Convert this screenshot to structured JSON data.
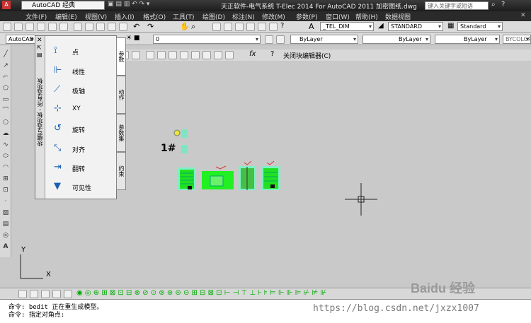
{
  "window": {
    "workspace": "AutoCAD 经典",
    "title": "天正软件-电气系统 T-Elec 2014  For AutoCAD 2011    加密图纸.dwg",
    "search_placeholder": "键入关键字或短语"
  },
  "menu": [
    "文件(F)",
    "编辑(E)",
    "视图(V)",
    "插入(I)",
    "格式(O)",
    "工具(T)",
    "绘图(D)",
    "标注(N)",
    "修改(M)",
    "参数(P)",
    "窗口(W)",
    "帮助(H)",
    "数据视图"
  ],
  "toolbar": {
    "dimstyle": "_TEL_DIM",
    "textstyle": "STANDARD",
    "tablestyle": "Standard"
  },
  "layers": {
    "workspace2": "AutoCAD 经",
    "layer": "0",
    "color": "ByLayer",
    "linetype": "ByLayer",
    "lineweight": "ByLayer",
    "plotstyle": "BYCOLOR"
  },
  "block_editor": {
    "close_label": "关闭块编辑器(C)"
  },
  "palette": {
    "title": "块编写选项板 - 所有选项板",
    "items": [
      {
        "label": "点",
        "icon": "point-param-icon"
      },
      {
        "label": "线性",
        "icon": "linear-param-icon"
      },
      {
        "label": "极轴",
        "icon": "polar-param-icon"
      },
      {
        "label": "XY",
        "icon": "xy-param-icon"
      },
      {
        "label": "旋转",
        "icon": "rotate-param-icon"
      },
      {
        "label": "对齐",
        "icon": "align-param-icon"
      },
      {
        "label": "翻转",
        "icon": "flip-param-icon"
      },
      {
        "label": "可见性",
        "icon": "visibility-param-icon"
      }
    ],
    "tabs": [
      "参数",
      "动作",
      "参数集",
      "约束"
    ]
  },
  "drawing": {
    "label_1": "1#"
  },
  "ucs": {
    "x": "X",
    "y": "Y"
  },
  "command": {
    "line1": "命令:  bedit 正在重生成模型。",
    "line2": "命令: 指定对角点:"
  },
  "watermarks": {
    "url": "https://blog.csdn.net/jxzx1007",
    "brand": "Baidu 经验"
  }
}
